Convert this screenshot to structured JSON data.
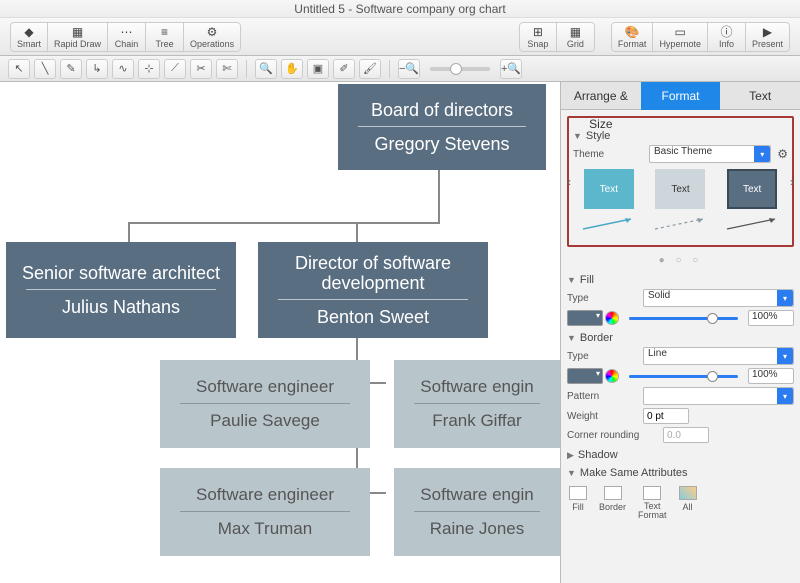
{
  "title": "Untitled 5 - Software company org chart",
  "toolbar": {
    "groups": [
      {
        "items": [
          "Smart",
          "Rapid Draw",
          "Chain",
          "Tree",
          "Operations"
        ]
      },
      {
        "items": [
          "Snap",
          "Grid"
        ]
      },
      {
        "items": [
          "Format",
          "Hypernote",
          "Info",
          "Present"
        ]
      }
    ]
  },
  "org": {
    "board": {
      "role": "Board of directors",
      "person": "Gregory Stevens"
    },
    "architect": {
      "role": "Senior software architect",
      "person": "Julius Nathans"
    },
    "director": {
      "role": "Director of software development",
      "person": "Benton Sweet"
    },
    "eng1": {
      "role": "Software engineer",
      "person": "Paulie Savege"
    },
    "eng2": {
      "role": "Software engin",
      "person": "Frank Giffar"
    },
    "eng3": {
      "role": "Software engineer",
      "person": "Max Truman"
    },
    "eng4": {
      "role": "Software engin",
      "person": "Raine Jones"
    }
  },
  "panel": {
    "tabs": {
      "arrange": "Arrange & Size",
      "format": "Format",
      "text": "Text"
    },
    "style_section": "Style",
    "theme_label": "Theme",
    "theme_value": "Basic Theme",
    "swatch_text": "Text",
    "dots": "● ○ ○",
    "fill_section": "Fill",
    "type_label": "Type",
    "fill_type": "Solid",
    "fill_pct": "100%",
    "border_section": "Border",
    "border_type": "Line",
    "border_pct": "100%",
    "pattern_label": "Pattern",
    "weight_label": "Weight",
    "weight_value": "0 pt",
    "corner_label": "Corner rounding",
    "corner_value": "0.0",
    "shadow_section": "Shadow",
    "make_same": "Make Same Attributes",
    "attr": {
      "fill": "Fill",
      "border": "Border",
      "textfmt": "Text\nFormat",
      "all": "All"
    }
  }
}
